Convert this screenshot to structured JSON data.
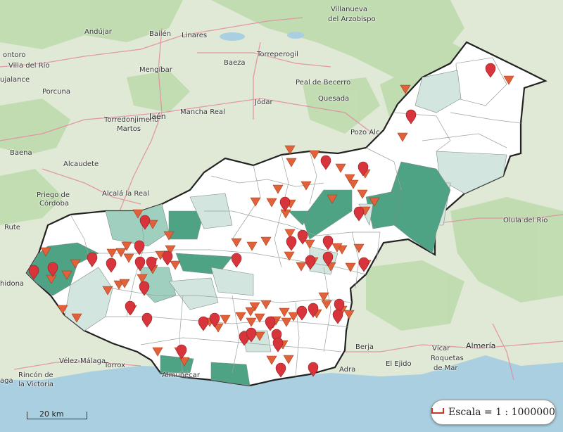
{
  "map": {
    "scale_bar_label": "20 km",
    "scale_box_text": "Escala = 1 : 1000000",
    "colors": {
      "sea": "#a9cfe0",
      "land": "#dfe9d5",
      "province_fill": "#ffffff",
      "shade_light": "#d2e6df",
      "shade_mid": "#9fd0bf",
      "shade_dark": "#4ea384",
      "boundary": "#222222",
      "marker_red": "#d8343b",
      "triangle_orange": "#e0613a",
      "road": "#e58aa0"
    },
    "icons": [
      "map-pin-icon",
      "triangle-down-icon",
      "scale-icon"
    ],
    "place_labels": [
      {
        "id": "villanueva",
        "text": "Villanueva",
        "big": false
      },
      {
        "id": "arzobispo",
        "text": "del Arzobispo",
        "big": false
      },
      {
        "id": "montoro",
        "text": "ontoro",
        "big": false
      },
      {
        "id": "villadelrio",
        "text": "Villa del Río",
        "big": false
      },
      {
        "id": "andujar",
        "text": "Andújar",
        "big": false
      },
      {
        "id": "bailen",
        "text": "Bailén",
        "big": false
      },
      {
        "id": "linares",
        "text": "Linares",
        "big": false
      },
      {
        "id": "torreperogil",
        "text": "Torreperogil",
        "big": false
      },
      {
        "id": "jalance",
        "text": "ujalance",
        "big": false
      },
      {
        "id": "porcuna",
        "text": "Porcuna",
        "big": false
      },
      {
        "id": "mengibar",
        "text": "Mengíbar",
        "big": false
      },
      {
        "id": "baeza",
        "text": "Baeza",
        "big": false
      },
      {
        "id": "pealdebecerro",
        "text": "Peal de Becerro",
        "big": false
      },
      {
        "id": "torredonjimeno",
        "text": "Torredonjimeno",
        "big": false
      },
      {
        "id": "martos",
        "text": "Martos",
        "big": false
      },
      {
        "id": "jaen",
        "text": "Jaén",
        "big": true
      },
      {
        "id": "manchareal",
        "text": "Mancha Real",
        "big": false
      },
      {
        "id": "jodar",
        "text": "Jódar",
        "big": false
      },
      {
        "id": "quesada",
        "text": "Quesada",
        "big": false
      },
      {
        "id": "pozoalcon",
        "text": "Pozo Alc",
        "big": false
      },
      {
        "id": "baena",
        "text": "Baena",
        "big": false
      },
      {
        "id": "alcaudete",
        "text": "Alcaudete",
        "big": false
      },
      {
        "id": "priego",
        "text": "Priego de",
        "big": false
      },
      {
        "id": "cordoba",
        "text": "Córdoba",
        "big": false
      },
      {
        "id": "alcalareal",
        "text": "Alcalá la Real",
        "big": false
      },
      {
        "id": "rute",
        "text": "Rute",
        "big": false
      },
      {
        "id": "hidona",
        "text": "hidona",
        "big": false
      },
      {
        "id": "oluladelrio",
        "text": "Olula del Río",
        "big": false
      },
      {
        "id": "berja",
        "text": "Berja",
        "big": false
      },
      {
        "id": "vicar",
        "text": "Vícar",
        "big": false
      },
      {
        "id": "almeria",
        "text": "Almería",
        "big": true
      },
      {
        "id": "roquetas",
        "text": "Roquetas",
        "big": false
      },
      {
        "id": "demar",
        "text": "de Mar",
        "big": false
      },
      {
        "id": "elejido",
        "text": "El Ejido",
        "big": false
      },
      {
        "id": "adra",
        "text": "Adra",
        "big": false
      },
      {
        "id": "velez",
        "text": "Vélez-Málaga",
        "big": false
      },
      {
        "id": "torrox",
        "text": "Torrox",
        "big": false
      },
      {
        "id": "rincon",
        "text": "Rincón de",
        "big": false
      },
      {
        "id": "lavictoria",
        "text": "la Victoria",
        "big": false
      },
      {
        "id": "almunecar",
        "text": "Almuñécar",
        "big": false
      },
      {
        "id": "aga",
        "text": "aga",
        "big": false
      }
    ]
  }
}
